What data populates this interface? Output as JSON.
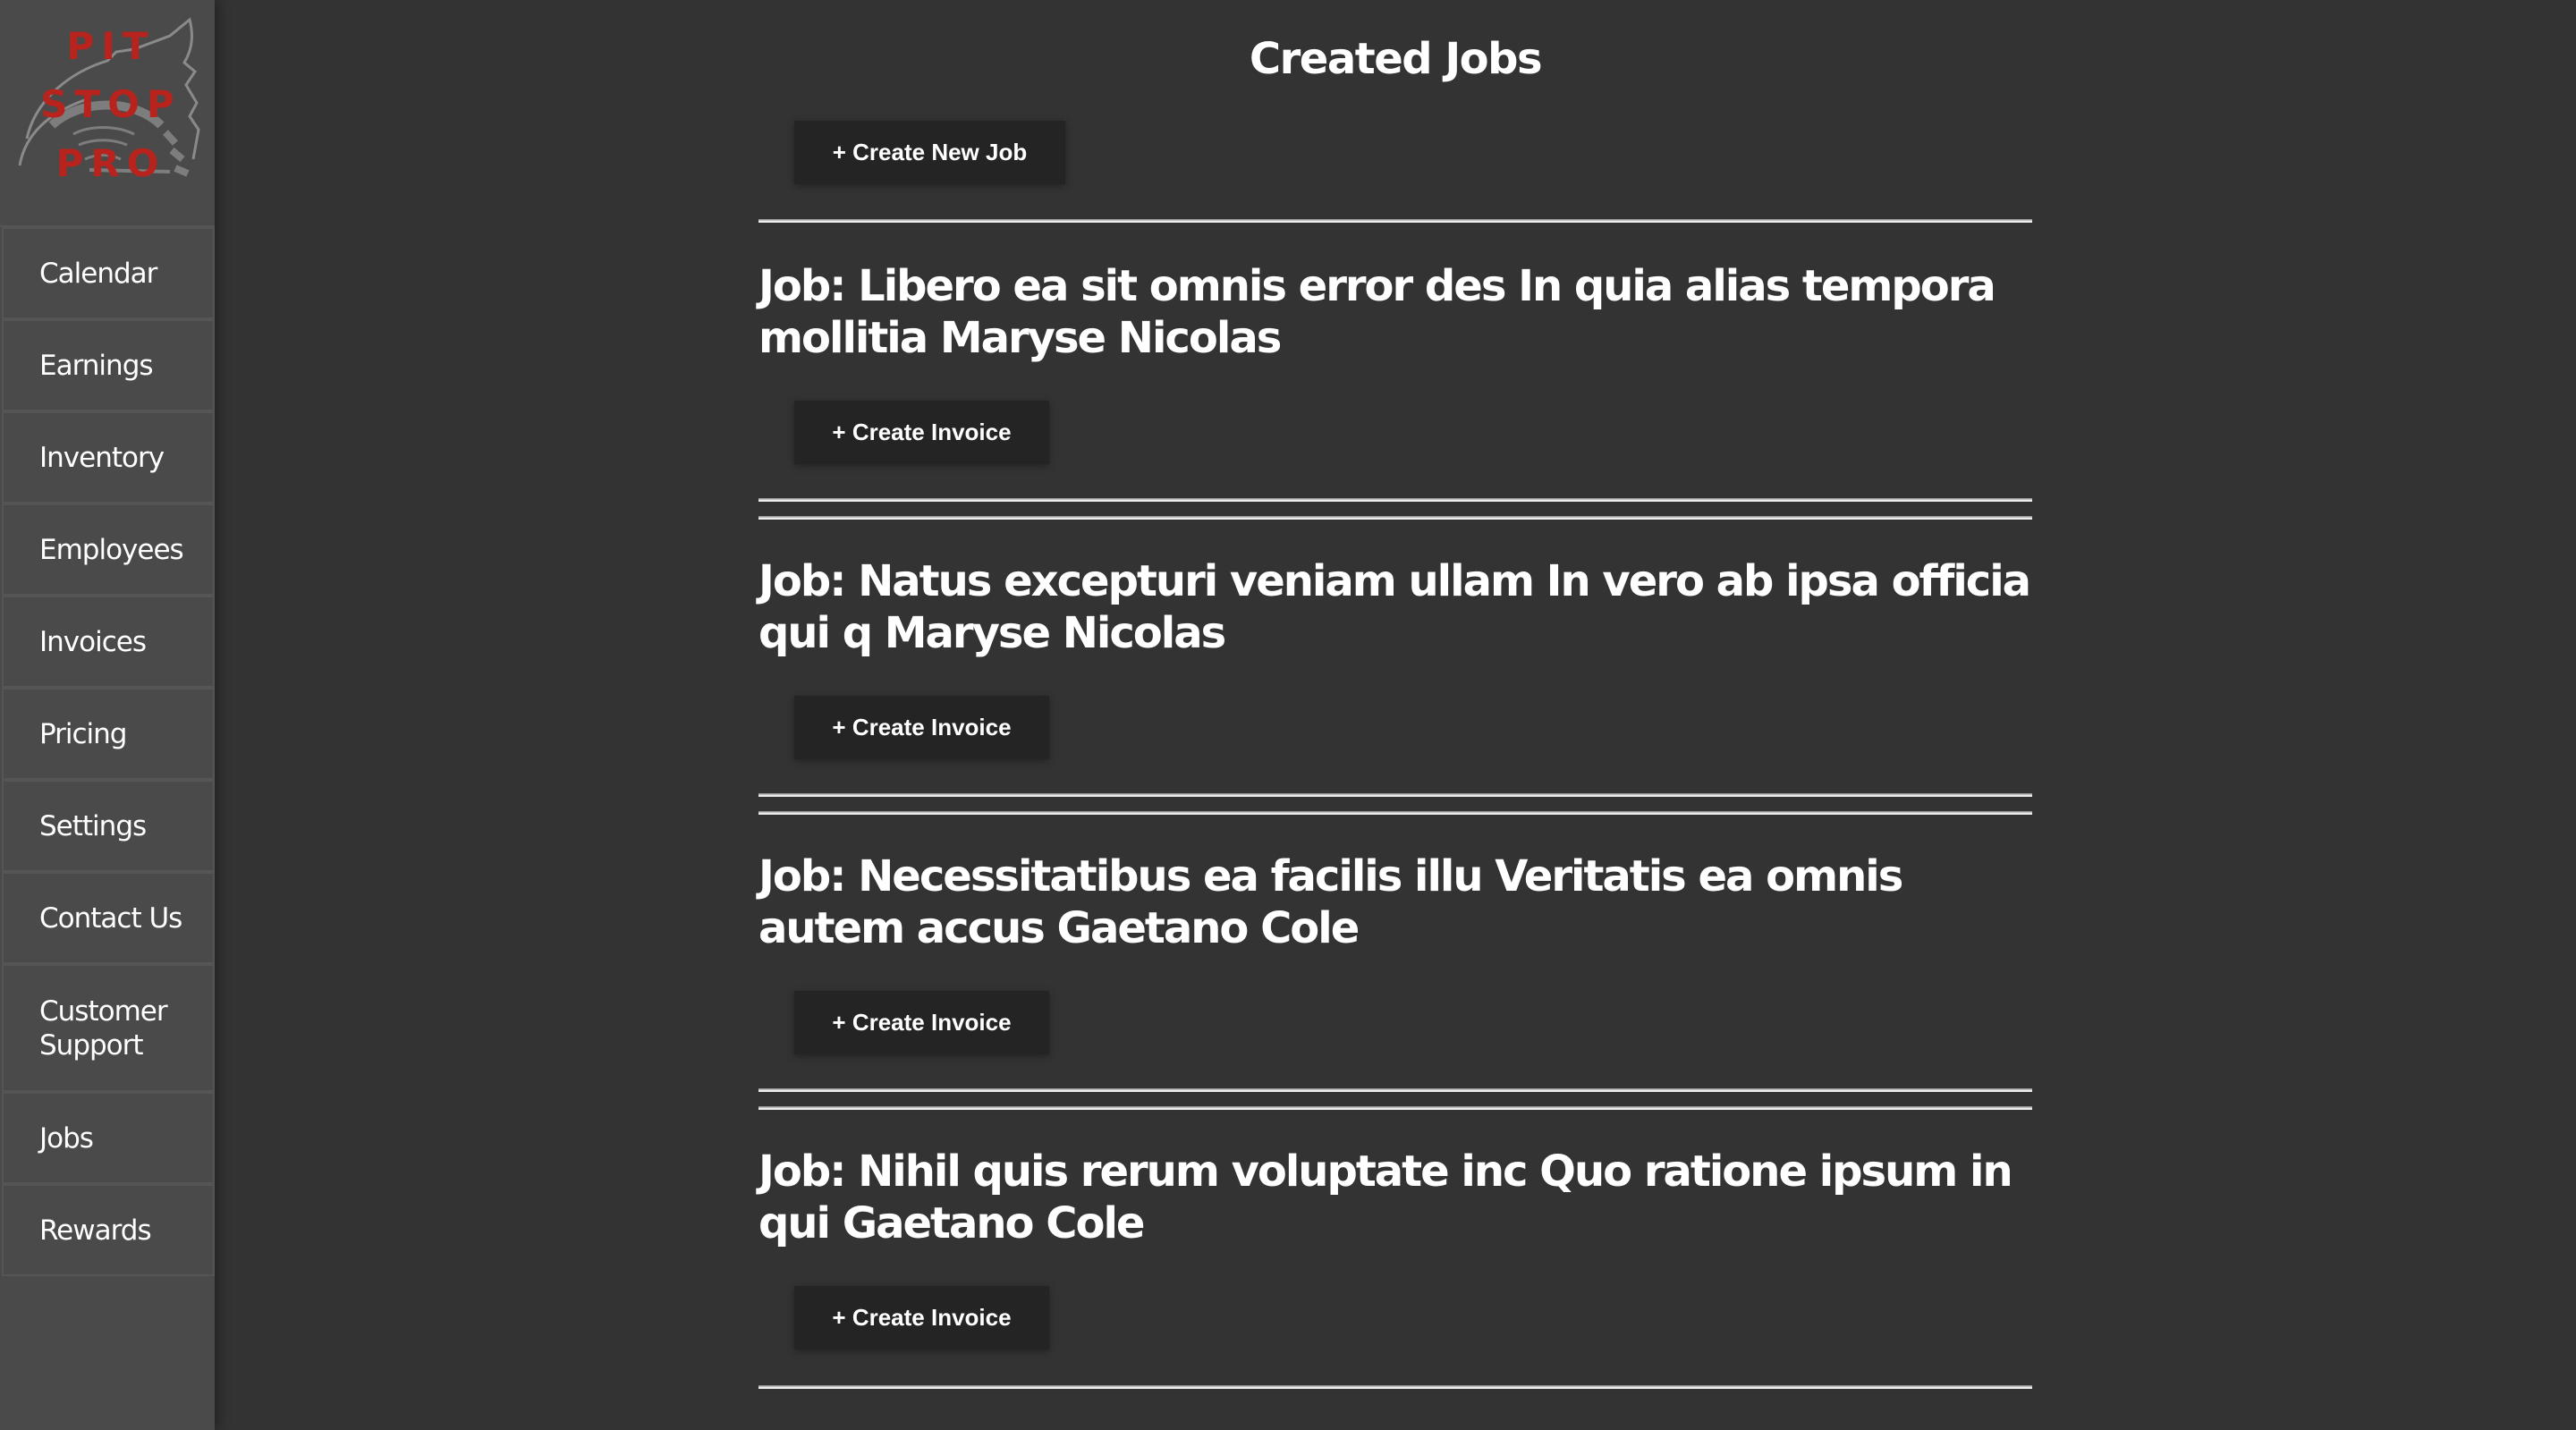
{
  "brand": {
    "logo_lines": [
      "PIT",
      "STOP",
      "PRO"
    ],
    "logo_color": "#b8231e"
  },
  "sidebar": {
    "items": [
      {
        "label": "Calendar"
      },
      {
        "label": "Earnings"
      },
      {
        "label": "Inventory"
      },
      {
        "label": "Employees"
      },
      {
        "label": "Invoices"
      },
      {
        "label": "Pricing"
      },
      {
        "label": "Settings"
      },
      {
        "label": "Contact Us"
      },
      {
        "label": "Customer Support"
      },
      {
        "label": "Jobs"
      },
      {
        "label": "Rewards"
      }
    ]
  },
  "main": {
    "title": "Created Jobs",
    "create_job_label": "+ Create New Job",
    "jobs": [
      {
        "title": "Job: Libero ea sit omnis error des In quia alias tempora mollitia Maryse Nicolas",
        "button_label": "+ Create Invoice"
      },
      {
        "title": "Job: Natus excepturi veniam ullam In vero ab ipsa officia qui q Maryse Nicolas",
        "button_label": "+ Create Invoice"
      },
      {
        "title": "Job: Necessitatibus ea facilis illu Veritatis ea omnis autem accus Gaetano Cole",
        "button_label": "+ Create Invoice"
      },
      {
        "title": "Job: Nihil quis rerum voluptate inc Quo ratione ipsum in qui Gaetano Cole",
        "button_label": "+ Create Invoice"
      }
    ]
  }
}
